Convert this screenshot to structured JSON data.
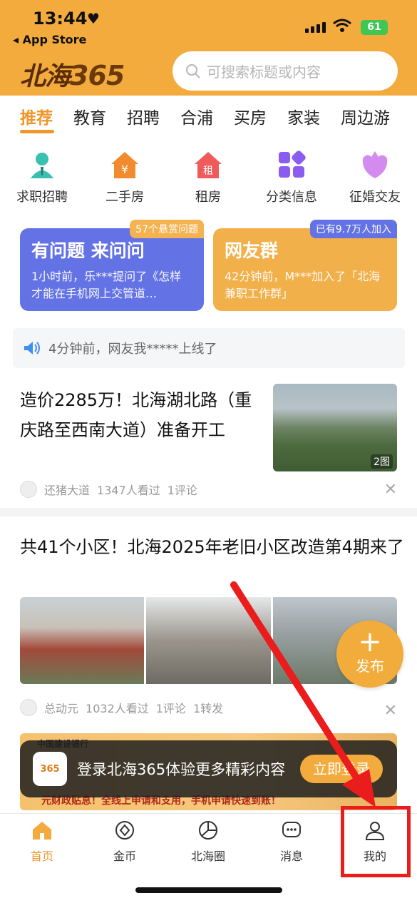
{
  "status_bar": {
    "time": "13:44",
    "back_label": "App Store",
    "battery": "61"
  },
  "header": {
    "logo_text": "北海",
    "logo_number": "365",
    "search_placeholder": "可搜索标题或内容"
  },
  "tabs": [
    {
      "label": "推荐",
      "active": true
    },
    {
      "label": "教育"
    },
    {
      "label": "招聘"
    },
    {
      "label": "合浦"
    },
    {
      "label": "买房"
    },
    {
      "label": "家装"
    },
    {
      "label": "周边游"
    }
  ],
  "shortcuts": [
    {
      "label": "求职招聘",
      "icon": "job-person-icon"
    },
    {
      "label": "二手房",
      "icon": "house-yuan-icon",
      "glyph": "¥"
    },
    {
      "label": "租房",
      "icon": "house-rent-icon",
      "glyph": "租"
    },
    {
      "label": "分类信息",
      "icon": "category-grid-icon"
    },
    {
      "label": "征婚交友",
      "icon": "heart-flower-icon"
    }
  ],
  "cards": [
    {
      "title": "有问题 来问问",
      "badge": "57个悬赏问题",
      "desc": "1小时前，乐***提问了《怎样才能在手机网上交管道…"
    },
    {
      "title": "网友群",
      "badge": "已有9.7万人加入",
      "desc": "42分钟前，M***加入了「北海兼职工作群」"
    }
  ],
  "notice": {
    "text": "4分钟前，网友我*****上线了"
  },
  "articles": [
    {
      "title": "造价2285万！北海湖北路（重庆路至西南大道）准备开工",
      "image_count": "2图",
      "author": "还猪大道",
      "views": "1347人看过",
      "comments": "1评论"
    },
    {
      "title": "共41个小区！北海2025年老旧小区改造第4期来了",
      "author": "总动元",
      "views": "1032人看过",
      "comments": "1评论",
      "shares": "1转发"
    }
  ],
  "publish_button": {
    "label": "发布"
  },
  "ad": {
    "bank": "中国建设银行",
    "bottom_text": "元财政贴息！全线上申请和支用，手机申请快速到账！"
  },
  "login_prompt": {
    "app_icon_text": "365",
    "text": "登录北海365体验更多精彩内容",
    "button": "立即登录"
  },
  "tabbar": [
    {
      "label": "首页",
      "icon": "home-icon",
      "active": true
    },
    {
      "label": "金币",
      "icon": "coin-icon"
    },
    {
      "label": "北海圈",
      "icon": "circle-community-icon"
    },
    {
      "label": "消息",
      "icon": "message-icon"
    },
    {
      "label": "我的",
      "icon": "profile-icon"
    }
  ],
  "colors": {
    "brand": "#f3ab3e",
    "accent": "#f0962b",
    "card_blue": "#6372e4",
    "annotation_red": "#ea1c1c"
  }
}
